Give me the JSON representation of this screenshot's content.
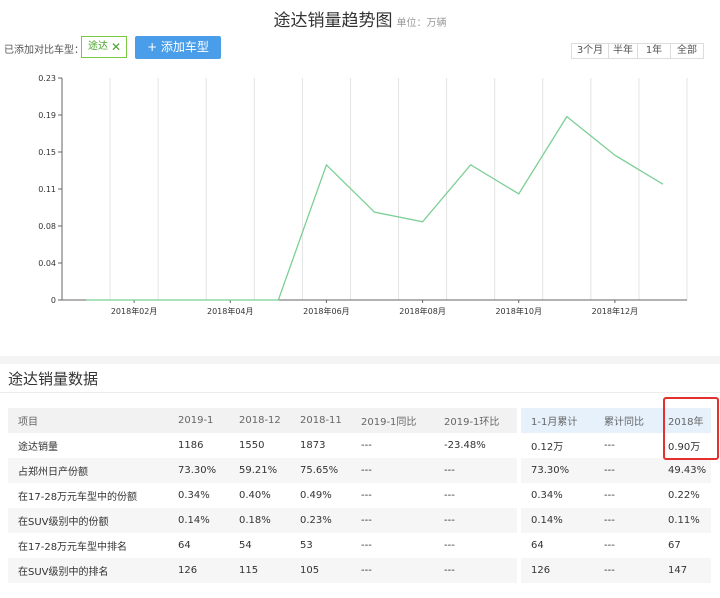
{
  "header": {
    "title": "途达销量趋势图",
    "unit": "单位：万辆"
  },
  "compare": {
    "label": "已添加对比车型：",
    "tag_label": "途达",
    "add_label": "+ 添加车型"
  },
  "range_tabs": [
    {
      "label": "3个月",
      "active": false
    },
    {
      "label": "半年",
      "active": false
    },
    {
      "label": "1年",
      "active": true
    },
    {
      "label": "全部",
      "active": false
    }
  ],
  "chart_data": {
    "type": "line",
    "x": [
      "2018-01",
      "2018-02",
      "2018-03",
      "2018-04",
      "2018-05",
      "2018-06",
      "2018-07",
      "2018-08",
      "2018-09",
      "2018-10",
      "2018-11",
      "2018-12",
      "2019-01"
    ],
    "x_tick_labels": [
      "2018年02月",
      "2018年04月",
      "2018年06月",
      "2018年08月",
      "2018年10月",
      "2018年12月"
    ],
    "series": [
      {
        "values": [
          0,
          0,
          0,
          0,
          0,
          0.14,
          0.091,
          0.081,
          0.14,
          0.11,
          0.19,
          0.15,
          0.12
        ],
        "color": "#7ccf95"
      }
    ],
    "ylim": [
      0,
      0.23
    ],
    "y_ticks": [
      "0",
      "0.04",
      "0.08",
      "0.11",
      "0.15",
      "0.19",
      "0.23"
    ],
    "grid": true
  },
  "section": {
    "title": "途达销量数据"
  },
  "table": {
    "headers": [
      "项目",
      "2019-1",
      "2018-12",
      "2018-11",
      "2019-1同比",
      "2019-1环比",
      "1-1月累计",
      "累计同比",
      "2018年"
    ],
    "rows": [
      [
        "途达销量",
        "1186",
        "1550",
        "1873",
        "---",
        "-23.48%",
        "0.12万",
        "---",
        "0.90万"
      ],
      [
        "占郑州日产份额",
        "73.30%",
        "59.21%",
        "75.65%",
        "---",
        "---",
        "73.30%",
        "---",
        "49.43%"
      ],
      [
        "在17-28万元车型中的份额",
        "0.34%",
        "0.40%",
        "0.49%",
        "---",
        "---",
        "0.34%",
        "---",
        "0.22%"
      ],
      [
        "在SUV级别中的份额",
        "0.14%",
        "0.18%",
        "0.23%",
        "---",
        "---",
        "0.14%",
        "---",
        "0.11%"
      ],
      [
        "在17-28万元车型中排名",
        "64",
        "54",
        "53",
        "---",
        "---",
        "64",
        "---",
        "67"
      ],
      [
        "在SUV级别中的排名",
        "126",
        "115",
        "105",
        "---",
        "---",
        "126",
        "---",
        "147"
      ]
    ]
  },
  "colors": {
    "accent": "#4a9de8",
    "line": "#7ccf95",
    "highlight": "#e53030",
    "tag": "#7ac943"
  }
}
